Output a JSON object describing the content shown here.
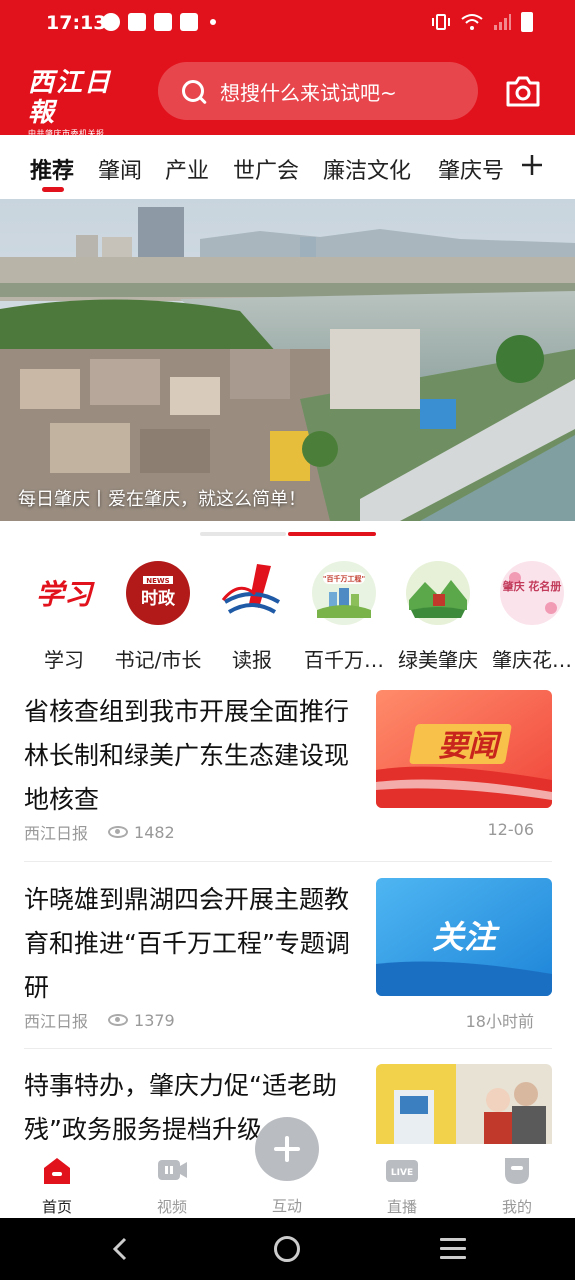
{
  "status": {
    "time": "17:13"
  },
  "header": {
    "logo_text": "西江日報",
    "logo_sub": "中共肇庆市委机关报",
    "search_placeholder": "想搜什么来试试吧~",
    "camera_icon": "camera-icon"
  },
  "tabs": [
    {
      "label": "推荐",
      "active": true
    },
    {
      "label": "肇闻"
    },
    {
      "label": "产业"
    },
    {
      "label": "世广会"
    },
    {
      "label": "廉洁文化"
    },
    {
      "label": "肇庆号"
    }
  ],
  "banner": {
    "caption": "每日肇庆丨爱在肇庆，就这么简单！"
  },
  "shortcuts": [
    {
      "label": "学习",
      "icon_text": "学习"
    },
    {
      "label": "书记/市长",
      "icon_text": "时政",
      "icon_small": "NEWS"
    },
    {
      "label": "读报"
    },
    {
      "label": "百千万…",
      "icon_text": "\"百千万工程\""
    },
    {
      "label": "绿美肇庆"
    },
    {
      "label": "肇庆花…",
      "icon_text": "肇庆 花名册"
    }
  ],
  "news": [
    {
      "title": "省核查组到我市开展全面推行林长制和绿美广东生态建设现地核查",
      "source": "西江日报",
      "views": "1482",
      "time": "12-06",
      "thumb_text": "要闻"
    },
    {
      "title": "许晓雄到鼎湖四会开展主题教育和推进“百千万工程”专题调研",
      "source": "西江日报",
      "views": "1379",
      "time": "18小时前",
      "thumb_text": "关注"
    },
    {
      "title": "特事特办，肇庆力促“适老助残”政务服务提档升级"
    }
  ],
  "bottom_nav": [
    {
      "label": "首页",
      "active": true
    },
    {
      "label": "视频"
    },
    {
      "label": "互动"
    },
    {
      "label": "直播",
      "icon_text": "LIVE"
    },
    {
      "label": "我的"
    }
  ],
  "colors": {
    "brand": "#e2121c"
  }
}
